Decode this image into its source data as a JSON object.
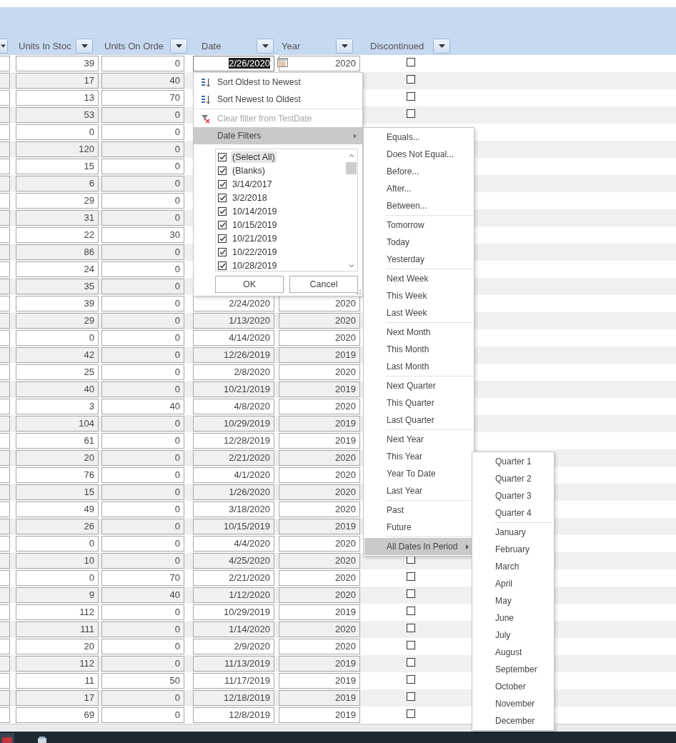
{
  "columns": [
    {
      "label": "Units In Stoc"
    },
    {
      "label": "Units On Orde"
    },
    {
      "label": "Date"
    },
    {
      "label": "Year"
    },
    {
      "label": "Discontinued"
    }
  ],
  "rows": [
    {
      "in_stock": "39",
      "on_order": "0",
      "date": "2/26/2020",
      "year": "2020",
      "selected": true,
      "discontinued": false
    },
    {
      "in_stock": "17",
      "on_order": "40",
      "discontinued": false
    },
    {
      "in_stock": "13",
      "on_order": "70",
      "discontinued": false
    },
    {
      "in_stock": "53",
      "on_order": "0",
      "discontinued": false
    },
    {
      "in_stock": "0",
      "on_order": "0"
    },
    {
      "in_stock": "120",
      "on_order": "0"
    },
    {
      "in_stock": "15",
      "on_order": "0"
    },
    {
      "in_stock": "6",
      "on_order": "0"
    },
    {
      "in_stock": "29",
      "on_order": "0"
    },
    {
      "in_stock": "31",
      "on_order": "0"
    },
    {
      "in_stock": "22",
      "on_order": "30"
    },
    {
      "in_stock": "86",
      "on_order": "0"
    },
    {
      "in_stock": "24",
      "on_order": "0"
    },
    {
      "in_stock": "35",
      "on_order": "0"
    },
    {
      "in_stock": "39",
      "on_order": "0",
      "date": "2/24/2020",
      "year": "2020",
      "selected": false
    },
    {
      "in_stock": "29",
      "on_order": "0",
      "date": "1/13/2020",
      "year": "2020",
      "selected": false
    },
    {
      "in_stock": "0",
      "on_order": "0",
      "date": "4/14/2020",
      "year": "2020",
      "selected": false
    },
    {
      "in_stock": "42",
      "on_order": "0",
      "date": "12/26/2019",
      "year": "2019",
      "selected": false
    },
    {
      "in_stock": "25",
      "on_order": "0",
      "date": "2/8/2020",
      "year": "2020",
      "selected": false
    },
    {
      "in_stock": "40",
      "on_order": "0",
      "date": "10/21/2019",
      "year": "2019",
      "selected": false
    },
    {
      "in_stock": "3",
      "on_order": "40",
      "date": "4/8/2020",
      "year": "2020",
      "selected": false
    },
    {
      "in_stock": "104",
      "on_order": "0",
      "date": "10/29/2019",
      "year": "2019",
      "selected": false
    },
    {
      "in_stock": "61",
      "on_order": "0",
      "date": "12/28/2019",
      "year": "2019",
      "selected": false
    },
    {
      "in_stock": "20",
      "on_order": "0",
      "date": "2/21/2020",
      "year": "2020",
      "selected": false
    },
    {
      "in_stock": "76",
      "on_order": "0",
      "date": "4/1/2020",
      "year": "2020",
      "selected": false
    },
    {
      "in_stock": "15",
      "on_order": "0",
      "date": "1/26/2020",
      "year": "2020",
      "selected": false
    },
    {
      "in_stock": "49",
      "on_order": "0",
      "date": "3/18/2020",
      "year": "2020",
      "selected": false
    },
    {
      "in_stock": "26",
      "on_order": "0",
      "date": "10/15/2019",
      "year": "2019",
      "selected": false
    },
    {
      "in_stock": "0",
      "on_order": "0",
      "date": "4/4/2020",
      "year": "2020",
      "selected": false
    },
    {
      "in_stock": "10",
      "on_order": "0",
      "date": "4/25/2020",
      "year": "2020",
      "selected": false,
      "discontinued": false
    },
    {
      "in_stock": "0",
      "on_order": "70",
      "date": "2/21/2020",
      "year": "2020",
      "selected": false,
      "discontinued": false
    },
    {
      "in_stock": "9",
      "on_order": "40",
      "date": "1/12/2020",
      "year": "2020",
      "selected": false,
      "discontinued": false
    },
    {
      "in_stock": "112",
      "on_order": "0",
      "date": "10/29/2019",
      "year": "2019",
      "selected": false,
      "discontinued": false
    },
    {
      "in_stock": "111",
      "on_order": "0",
      "date": "1/14/2020",
      "year": "2020",
      "selected": false,
      "discontinued": false
    },
    {
      "in_stock": "20",
      "on_order": "0",
      "date": "2/9/2020",
      "year": "2020",
      "selected": false,
      "discontinued": false
    },
    {
      "in_stock": "112",
      "on_order": "0",
      "date": "11/13/2019",
      "year": "2019",
      "selected": false,
      "discontinued": false
    },
    {
      "in_stock": "11",
      "on_order": "50",
      "date": "11/17/2019",
      "year": "2019",
      "selected": false,
      "discontinued": false
    },
    {
      "in_stock": "17",
      "on_order": "0",
      "date": "12/18/2019",
      "year": "2019",
      "selected": false,
      "discontinued": false
    },
    {
      "in_stock": "69",
      "on_order": "0",
      "date": "12/8/2019",
      "year": "2019",
      "selected": false,
      "discontinued": false
    }
  ],
  "filter_menu": {
    "command_groups": [
      [
        {
          "kind": "sort-asc",
          "label": "Sort Oldest to Newest",
          "disabled": false,
          "highlighted": false
        },
        {
          "kind": "sort-desc",
          "label": "Sort Newest to Oldest",
          "disabled": false,
          "highlighted": false
        }
      ],
      [
        {
          "kind": "clear",
          "label": "Clear filter from TestDate",
          "disabled": true,
          "highlighted": false
        },
        {
          "kind": "submenu",
          "label": "Date Filters",
          "disabled": false,
          "highlighted": true
        }
      ]
    ],
    "values": [
      {
        "label": "(Select All)",
        "checked": true,
        "selected": true
      },
      {
        "label": "(Blanks)",
        "checked": true,
        "selected": false
      },
      {
        "label": "3/14/2017",
        "checked": true,
        "selected": false
      },
      {
        "label": "3/2/2018",
        "checked": true,
        "selected": false
      },
      {
        "label": "10/14/2019",
        "checked": true,
        "selected": false
      },
      {
        "label": "10/15/2019",
        "checked": true,
        "selected": false
      },
      {
        "label": "10/21/2019",
        "checked": true,
        "selected": false
      },
      {
        "label": "10/22/2019",
        "checked": true,
        "selected": false
      },
      {
        "label": "10/28/2019",
        "checked": true,
        "selected": false
      }
    ],
    "buttons": [
      "OK",
      "Cancel"
    ]
  },
  "date_filters": {
    "groups": [
      [
        {
          "label": "Equals...",
          "highlighted": false,
          "arrow": false
        },
        {
          "label": "Does Not Equal...",
          "highlighted": false,
          "arrow": false
        },
        {
          "label": "Before...",
          "highlighted": false,
          "arrow": false
        },
        {
          "label": "After...",
          "highlighted": false,
          "arrow": false
        },
        {
          "label": "Between...",
          "highlighted": false,
          "arrow": false
        }
      ],
      [
        {
          "label": "Tomorrow",
          "highlighted": false,
          "arrow": false
        },
        {
          "label": "Today",
          "highlighted": false,
          "arrow": false
        },
        {
          "label": "Yesterday",
          "highlighted": false,
          "arrow": false
        }
      ],
      [
        {
          "label": "Next Week",
          "highlighted": false,
          "arrow": false
        },
        {
          "label": "This Week",
          "highlighted": false,
          "arrow": false
        },
        {
          "label": "Last Week",
          "highlighted": false,
          "arrow": false
        }
      ],
      [
        {
          "label": "Next Month",
          "highlighted": false,
          "arrow": false
        },
        {
          "label": "This Month",
          "highlighted": false,
          "arrow": false
        },
        {
          "label": "Last Month",
          "highlighted": false,
          "arrow": false
        }
      ],
      [
        {
          "label": "Next Quarter",
          "highlighted": false,
          "arrow": false
        },
        {
          "label": "This Quarter",
          "highlighted": false,
          "arrow": false
        },
        {
          "label": "Last Quarter",
          "highlighted": false,
          "arrow": false
        }
      ],
      [
        {
          "label": "Next Year",
          "highlighted": false,
          "arrow": false
        },
        {
          "label": "This Year",
          "highlighted": false,
          "arrow": false
        },
        {
          "label": "Year To Date",
          "highlighted": false,
          "arrow": false
        },
        {
          "label": "Last Year",
          "highlighted": false,
          "arrow": false
        }
      ],
      [
        {
          "label": "Past",
          "highlighted": false,
          "arrow": false
        },
        {
          "label": "Future",
          "highlighted": false,
          "arrow": false
        }
      ],
      [
        {
          "label": "All Dates In Period",
          "highlighted": true,
          "arrow": true
        }
      ]
    ]
  },
  "period_menu": {
    "groups": [
      [
        "Quarter 1",
        "Quarter 2",
        "Quarter 3",
        "Quarter 4"
      ],
      [
        "January",
        "February",
        "March",
        "April",
        "May",
        "June",
        "July",
        "August",
        "September",
        "October",
        "November",
        "December"
      ]
    ]
  }
}
